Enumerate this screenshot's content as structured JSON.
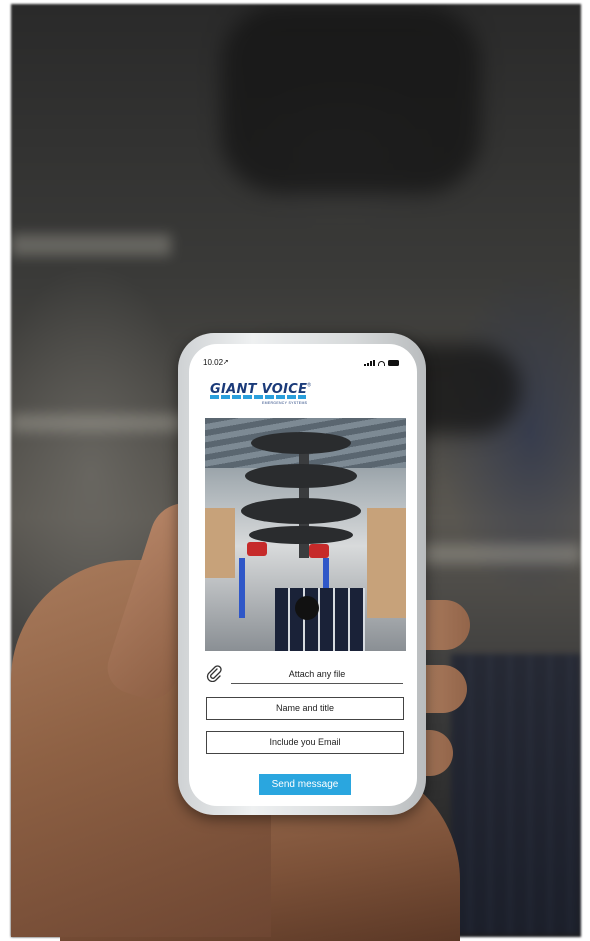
{
  "phone": {
    "status_time": "10.02",
    "brand": {
      "name": "GIANT VOICE",
      "registered": "®",
      "subtitle": "EMERGENCY SYSTEMS"
    },
    "form": {
      "attach_label": "Attach any file",
      "name_placeholder": "Name and title",
      "email_placeholder": "Include you Email",
      "submit_label": "Send message"
    }
  },
  "colors": {
    "accent": "#2aa6df",
    "brand_blue": "#1b3b7a"
  },
  "icons": [
    "location-arrow-icon",
    "signal-icon",
    "wifi-icon",
    "battery-icon",
    "paperclip-icon"
  ]
}
